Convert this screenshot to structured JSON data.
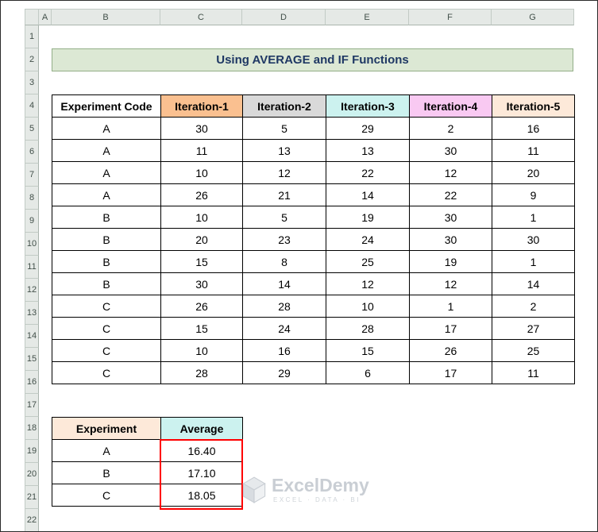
{
  "spreadsheet": {
    "column_headers": [
      "A",
      "B",
      "C",
      "D",
      "E",
      "F",
      "G"
    ],
    "row_headers": [
      "1",
      "2",
      "3",
      "4",
      "5",
      "6",
      "7",
      "8",
      "9",
      "10",
      "11",
      "12",
      "13",
      "14",
      "15",
      "16",
      "17",
      "18",
      "19",
      "20",
      "21",
      "22"
    ]
  },
  "title_banner": {
    "text": "Using AVERAGE and IF Functions",
    "bg": "#DCE8D4",
    "text_color": "#1F3864"
  },
  "main_table": {
    "headers": [
      "Experiment Code",
      "Iteration-1",
      "Iteration-2",
      "Iteration-3",
      "Iteration-4",
      "Iteration-5"
    ],
    "header_colors": [
      "#FFFFFF",
      "#FAC090",
      "#D9D9D9",
      "#CCF2EF",
      "#F9C9F2",
      "#FDE9D9"
    ],
    "rows": [
      [
        "A",
        "30",
        "5",
        "29",
        "2",
        "16"
      ],
      [
        "A",
        "11",
        "13",
        "13",
        "30",
        "11"
      ],
      [
        "A",
        "10",
        "12",
        "22",
        "12",
        "20"
      ],
      [
        "A",
        "26",
        "21",
        "14",
        "22",
        "9"
      ],
      [
        "B",
        "10",
        "5",
        "19",
        "30",
        "1"
      ],
      [
        "B",
        "20",
        "23",
        "24",
        "30",
        "30"
      ],
      [
        "B",
        "15",
        "8",
        "25",
        "19",
        "1"
      ],
      [
        "B",
        "30",
        "14",
        "12",
        "12",
        "14"
      ],
      [
        "C",
        "26",
        "28",
        "10",
        "1",
        "2"
      ],
      [
        "C",
        "15",
        "24",
        "28",
        "17",
        "27"
      ],
      [
        "C",
        "10",
        "16",
        "15",
        "26",
        "25"
      ],
      [
        "C",
        "28",
        "29",
        "6",
        "17",
        "11"
      ]
    ]
  },
  "summary_table": {
    "headers": [
      "Experiment",
      "Average"
    ],
    "header_colors": [
      "#FDE9D9",
      "#CCF2EF"
    ],
    "rows": [
      [
        "A",
        "16.40"
      ],
      [
        "B",
        "17.10"
      ],
      [
        "C",
        "18.05"
      ]
    ],
    "highlight_border_color": "#FF0000"
  },
  "watermark": {
    "brand": "ExcelDemy",
    "tagline": "EXCEL · DATA · BI"
  }
}
